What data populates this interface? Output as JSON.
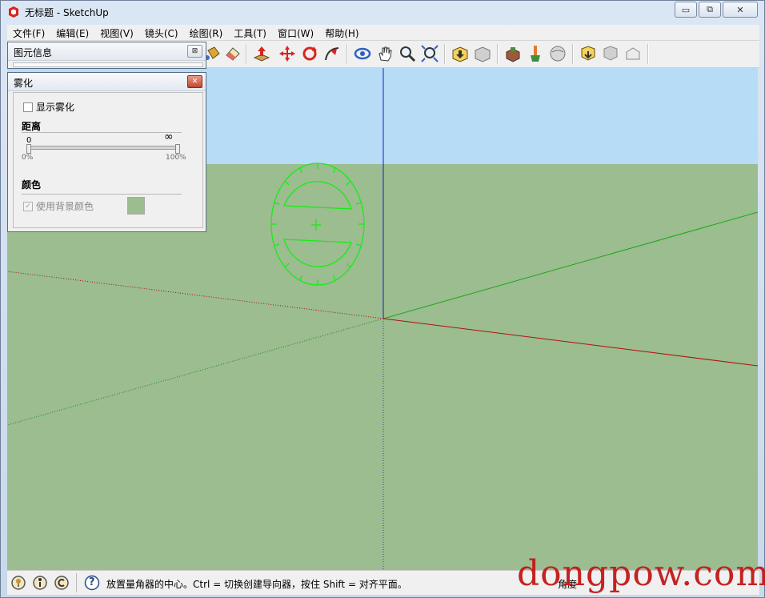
{
  "window": {
    "title": "无标题 - SketchUp",
    "min_glyph": "▭",
    "max_glyph": "⧉",
    "close_glyph": "✕"
  },
  "menu": [
    "文件(F)",
    "编辑(E)",
    "视图(V)",
    "镜头(C)",
    "绘图(R)",
    "工具(T)",
    "窗口(W)",
    "帮助(H)"
  ],
  "toolbar": {
    "icons": [
      "paint-bucket-icon",
      "eraser-icon",
      "push-pull-icon",
      "move-icon",
      "rotate-icon",
      "follow-me-icon",
      "orbit-icon",
      "pan-icon",
      "zoom-icon",
      "zoom-extents-icon",
      "warehouse-get-models-icon",
      "warehouse-share-model-icon",
      "components-icon",
      "styles-icon",
      "preview-earth-icon",
      "get-photo-texture-icon",
      "share-component-icon",
      "extension-warehouse-icon"
    ]
  },
  "entity_info_panel": {
    "title": "图元信息",
    "close_glyph": "⊠"
  },
  "fog_panel": {
    "title": "雾化",
    "close_glyph": "✕",
    "show_fog_label": "显示雾化",
    "show_fog_checked": false,
    "distance_label": "距离",
    "slider_start_value": "0",
    "slider_end_symbol": "∞",
    "slider_min_label": "0%",
    "slider_max_label": "100%",
    "color_label": "颜色",
    "use_bg_color_label": "使用背景颜色",
    "use_bg_color_checked": true,
    "swatch_color": "#9bbd8f"
  },
  "scene": {
    "sky_color": "#b7dcf5",
    "ground_color": "#9bbd8f"
  },
  "statusbar": {
    "icons": [
      "geo-location-icon",
      "credits-icon",
      "sign-in-icon"
    ],
    "help_glyph": "?",
    "text": "放置量角器的中心。Ctrl = 切换创建导向器，按住 Shift = 对齐平面。",
    "measurements_label": "角度"
  },
  "watermark": "dongpow.com"
}
